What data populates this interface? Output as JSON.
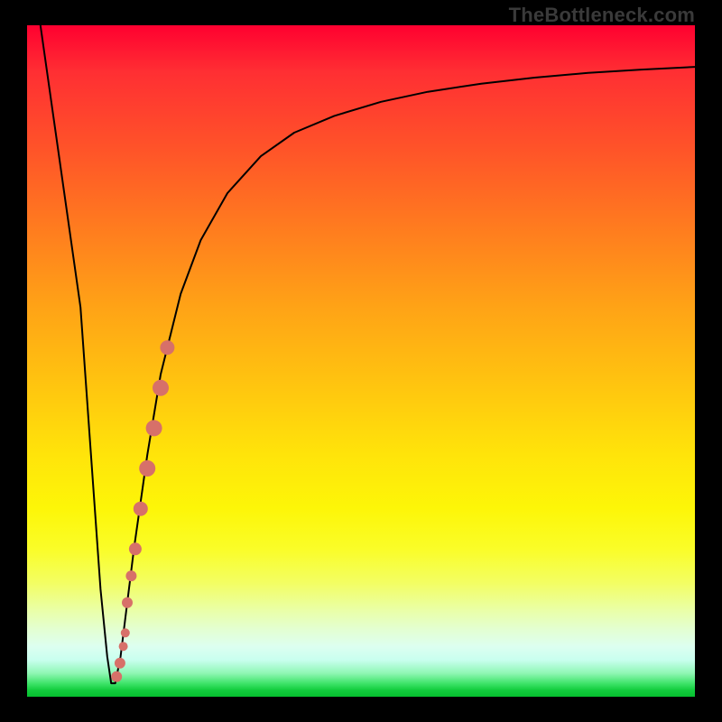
{
  "watermark": "TheBottleneck.com",
  "chart_data": {
    "type": "line",
    "title": "",
    "xlabel": "",
    "ylabel": "",
    "xlim": [
      0,
      100
    ],
    "ylim": [
      0,
      100
    ],
    "grid": false,
    "series": [
      {
        "name": "curve",
        "x": [
          2,
          4,
          6,
          8,
          9,
          10,
          11,
          12,
          12.6,
          13.2,
          14,
          15,
          16,
          18,
          20,
          23,
          26,
          30,
          35,
          40,
          46,
          53,
          60,
          68,
          76,
          84,
          92,
          100
        ],
        "y": [
          100,
          86,
          72,
          58,
          44,
          30,
          16,
          6,
          2,
          2,
          6,
          14,
          22,
          36,
          48,
          60,
          68,
          75,
          80.5,
          84,
          86.5,
          88.6,
          90.1,
          91.3,
          92.2,
          92.9,
          93.4,
          93.8
        ]
      }
    ],
    "markers": {
      "name": "highlight-dots",
      "color": "#d77069",
      "points": [
        {
          "x": 15.0,
          "y": 14,
          "r": 6
        },
        {
          "x": 15.6,
          "y": 18,
          "r": 6
        },
        {
          "x": 16.2,
          "y": 22,
          "r": 7
        },
        {
          "x": 17.0,
          "y": 28,
          "r": 8
        },
        {
          "x": 18.0,
          "y": 34,
          "r": 9
        },
        {
          "x": 19.0,
          "y": 40,
          "r": 9
        },
        {
          "x": 20.0,
          "y": 46,
          "r": 9
        },
        {
          "x": 21.0,
          "y": 52,
          "r": 8
        },
        {
          "x": 13.4,
          "y": 3.0,
          "r": 6
        },
        {
          "x": 13.9,
          "y": 5.0,
          "r": 6
        },
        {
          "x": 14.4,
          "y": 7.5,
          "r": 5
        },
        {
          "x": 14.7,
          "y": 9.5,
          "r": 5
        }
      ]
    }
  }
}
